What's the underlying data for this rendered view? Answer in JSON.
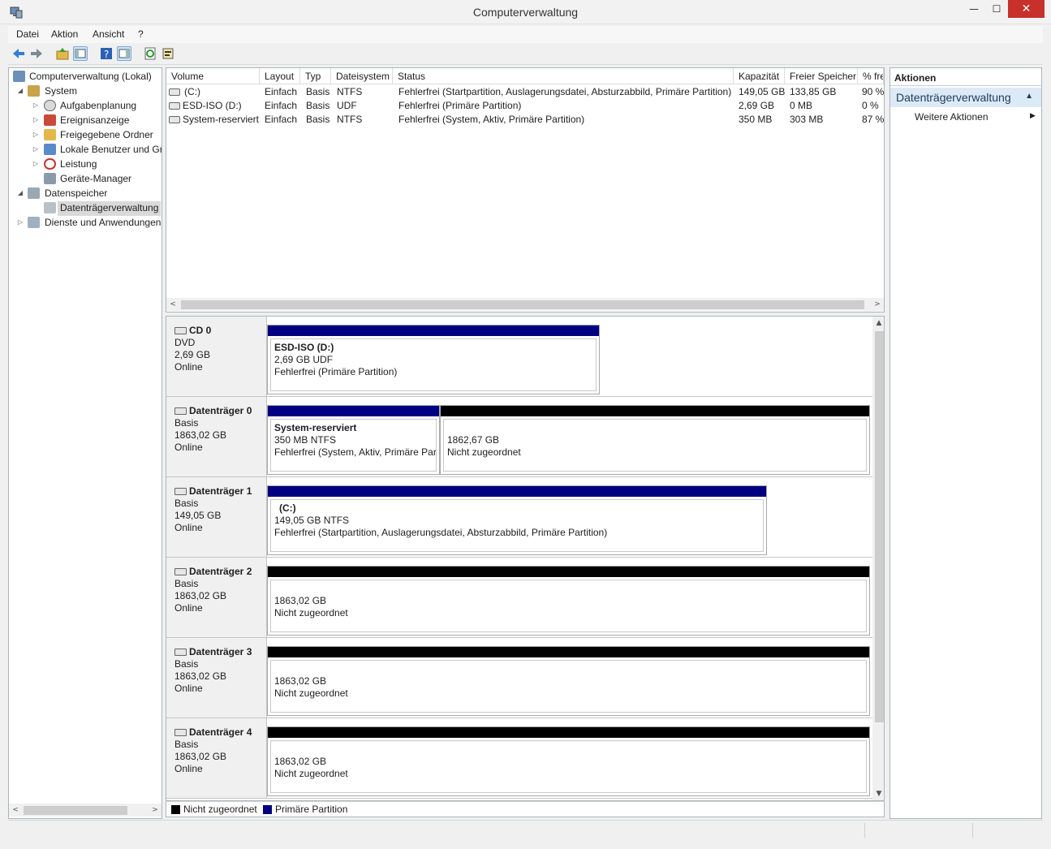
{
  "window": {
    "title": "Computerverwaltung"
  },
  "window_buttons": {
    "minimize": "—",
    "maximize": "☐",
    "close": "✕"
  },
  "menu": [
    "Datei",
    "Aktion",
    "Ansicht",
    "?"
  ],
  "toolbar_icons": [
    "back-icon",
    "forward-icon",
    "up-icon",
    "show-hide-console-tree-icon",
    "help-icon",
    "action-pane-icon",
    "refresh-icon",
    "properties-icon"
  ],
  "tree": [
    {
      "label": "Computerverwaltung (Lokal)",
      "icon": "computer-management-icon",
      "expanded": true
    },
    {
      "label": "System",
      "icon": "tools-icon",
      "expanded": true
    },
    {
      "label": "Aufgabenplanung",
      "icon": "clock-icon"
    },
    {
      "label": "Ereignisanzeige",
      "icon": "event-viewer-icon"
    },
    {
      "label": "Freigegebene Ordner",
      "icon": "shared-folder-icon"
    },
    {
      "label": "Lokale Benutzer und Gruppen",
      "icon": "users-icon"
    },
    {
      "label": "Leistung",
      "icon": "performance-icon"
    },
    {
      "label": "Geräte-Manager",
      "icon": "device-manager-icon"
    },
    {
      "label": "Datenspeicher",
      "icon": "storage-icon",
      "expanded": true
    },
    {
      "label": "Datenträgerverwaltung",
      "icon": "disk-management-icon",
      "selected": true
    },
    {
      "label": "Dienste und Anwendungen",
      "icon": "services-icon"
    }
  ],
  "volume_table": {
    "columns": [
      "Volume",
      "Layout",
      "Typ",
      "Dateisystem",
      "Status",
      "Kapazität",
      "Freier Speicher",
      "% frei"
    ],
    "rows": [
      [
        "(C:)",
        "Einfach",
        "Basis",
        "NTFS",
        "Fehlerfrei (Startpartition, Auslagerungsdatei, Absturzabbild, Primäre Partition)",
        "149,05 GB",
        "133,85 GB",
        "90 %"
      ],
      [
        "ESD-ISO (D:)",
        "Einfach",
        "Basis",
        "UDF",
        "Fehlerfrei (Primäre Partition)",
        "2,69 GB",
        "0 MB",
        "0 %"
      ],
      [
        "System-reserviert",
        "Einfach",
        "Basis",
        "NTFS",
        "Fehlerfrei (System, Aktiv, Primäre Partition)",
        "350 MB",
        "303 MB",
        "87 %"
      ]
    ]
  },
  "disks": [
    {
      "name": "CD 0",
      "type": "DVD",
      "size": "2,69 GB",
      "state": "Online",
      "partitions": [
        {
          "title": "ESD-ISO  (D:)",
          "line1": "2,69 GB UDF",
          "line2": "Fehlerfrei (Primäre Partition)",
          "kind": "primary"
        }
      ]
    },
    {
      "name": "Datenträger 0",
      "type": "Basis",
      "size": "1863,02 GB",
      "state": "Online",
      "partitions": [
        {
          "title": "System-reserviert",
          "line1": "350 MB NTFS",
          "line2": "Fehlerfrei (System, Aktiv, Primäre Partition)",
          "kind": "primary"
        },
        {
          "title": "",
          "line1": "1862,67 GB",
          "line2": "Nicht zugeordnet",
          "kind": "unallocated"
        }
      ]
    },
    {
      "name": "Datenträger 1",
      "type": "Basis",
      "size": "149,05 GB",
      "state": "Online",
      "partitions": [
        {
          "title": "(C:)",
          "line1": "149,05 GB NTFS",
          "line2": "Fehlerfrei (Startpartition, Auslagerungsdatei, Absturzabbild, Primäre Partition)",
          "kind": "primary"
        }
      ]
    },
    {
      "name": "Datenträger 2",
      "type": "Basis",
      "size": "1863,02 GB",
      "state": "Online",
      "partitions": [
        {
          "title": "",
          "line1": "1863,02 GB",
          "line2": "Nicht zugeordnet",
          "kind": "unallocated"
        }
      ]
    },
    {
      "name": "Datenträger 3",
      "type": "Basis",
      "size": "1863,02 GB",
      "state": "Online",
      "partitions": [
        {
          "title": "",
          "line1": "1863,02 GB",
          "line2": "Nicht zugeordnet",
          "kind": "unallocated"
        }
      ]
    },
    {
      "name": "Datenträger 4",
      "type": "Basis",
      "size": "1863,02 GB",
      "state": "Online",
      "partitions": [
        {
          "title": "",
          "line1": "1863,02 GB",
          "line2": "Nicht zugeordnet",
          "kind": "unallocated"
        }
      ]
    }
  ],
  "legend": [
    {
      "label": "Nicht zugeordnet",
      "color": "#000000"
    },
    {
      "label": "Primäre Partition",
      "color": "#000080"
    }
  ],
  "actions": {
    "header": "Aktionen",
    "section": "Datenträgerverwaltung",
    "items": [
      "Weitere Aktionen"
    ]
  },
  "colors": {
    "primary": "#000080",
    "unallocated": "#000000",
    "close": "#c7302b",
    "action_section": "#dceaf7"
  }
}
